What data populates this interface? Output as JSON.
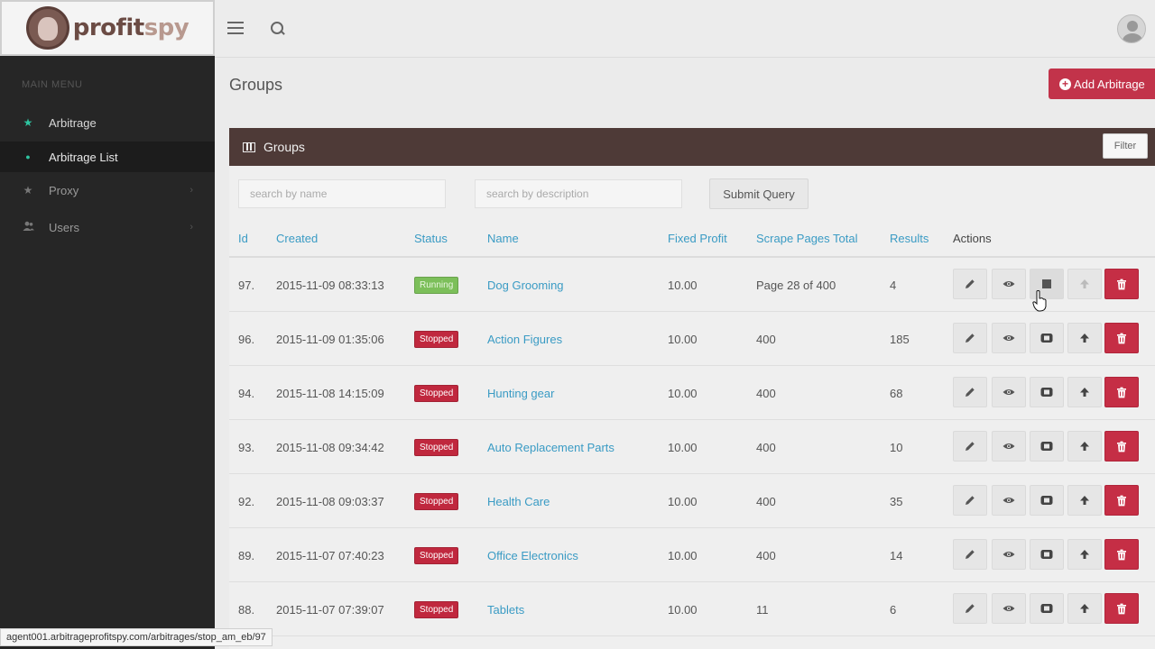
{
  "brand": {
    "name_part1": "profit",
    "name_part2": "spy"
  },
  "sidebar": {
    "heading": "MAIN MENU",
    "items": [
      {
        "label": "Arbitrage",
        "icon": "star-icon"
      },
      {
        "label": "Arbitrage List",
        "icon": "dot-icon"
      },
      {
        "label": "Proxy",
        "icon": "star-icon"
      },
      {
        "label": "Users",
        "icon": "users-icon"
      }
    ]
  },
  "page": {
    "title": "Groups",
    "add_button": "Add Arbitrage"
  },
  "panel": {
    "title": "Groups",
    "filter_button": "Filter",
    "search_name_placeholder": "search by name",
    "search_desc_placeholder": "search by description",
    "submit_button": "Submit Query"
  },
  "table": {
    "columns": [
      "Id",
      "Created",
      "Status",
      "Name",
      "Fixed Profit",
      "Scrape Pages Total",
      "Results",
      "Actions"
    ],
    "rows": [
      {
        "id": "97.",
        "created": "2015-11-09 08:33:13",
        "status": "Running",
        "name": "Dog Grooming",
        "fixed_profit": "10.00",
        "scrape_pages": "Page 28 of 400",
        "results": "4"
      },
      {
        "id": "96.",
        "created": "2015-11-09 01:35:06",
        "status": "Stopped",
        "name": "Action Figures",
        "fixed_profit": "10.00",
        "scrape_pages": "400",
        "results": "185"
      },
      {
        "id": "94.",
        "created": "2015-11-08 14:15:09",
        "status": "Stopped",
        "name": "Hunting gear",
        "fixed_profit": "10.00",
        "scrape_pages": "400",
        "results": "68"
      },
      {
        "id": "93.",
        "created": "2015-11-08 09:34:42",
        "status": "Stopped",
        "name": "Auto Replacement Parts",
        "fixed_profit": "10.00",
        "scrape_pages": "400",
        "results": "10"
      },
      {
        "id": "92.",
        "created": "2015-11-08 09:03:37",
        "status": "Stopped",
        "name": "Health Care",
        "fixed_profit": "10.00",
        "scrape_pages": "400",
        "results": "35"
      },
      {
        "id": "89.",
        "created": "2015-11-07 07:40:23",
        "status": "Stopped",
        "name": "Office Electronics",
        "fixed_profit": "10.00",
        "scrape_pages": "400",
        "results": "14"
      },
      {
        "id": "88.",
        "created": "2015-11-07 07:39:07",
        "status": "Stopped",
        "name": "Tablets",
        "fixed_profit": "10.00",
        "scrape_pages": "11",
        "results": "6"
      }
    ]
  },
  "status_bar": {
    "url": "agent001.arbitrageprofitspy.com/arbitrages/stop_am_eb/97"
  },
  "colors": {
    "accent_red": "#c2334a",
    "link_blue": "#3a9bc4",
    "running_green": "#7cbf5a",
    "panel_header": "#4e3a37",
    "sidebar_bg": "#262626",
    "sidebar_active_icon": "#2ec4a0"
  }
}
